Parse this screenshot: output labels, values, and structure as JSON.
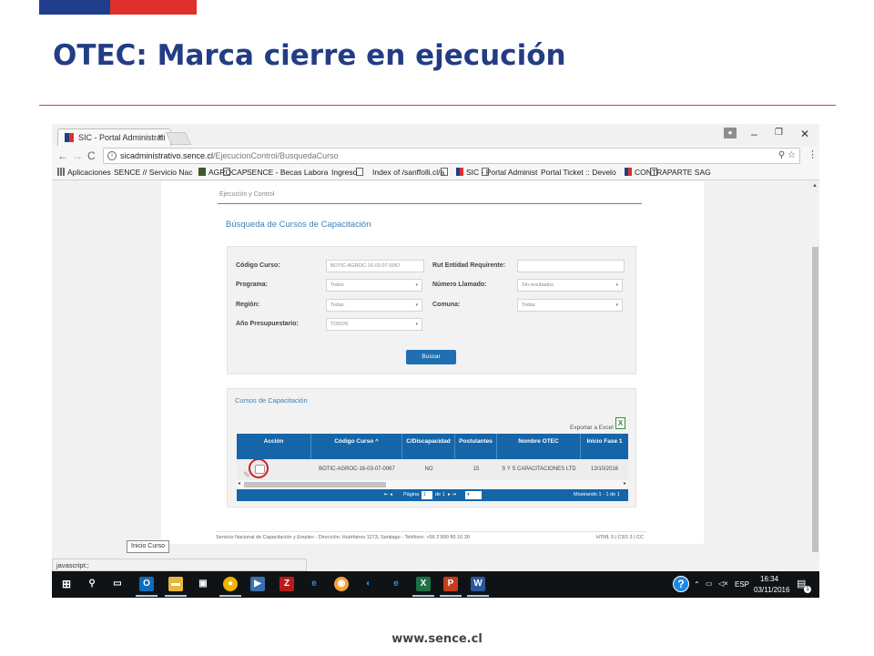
{
  "slide": {
    "title": "OTEC: Marca cierre en ejecución",
    "footer_url": "www.sence.cl",
    "brand_colors": {
      "blue": "#1f3e8c",
      "red": "#e0302c"
    }
  },
  "browser": {
    "tab_title": "SIC - Portal Administrati",
    "tab_close": "×",
    "url_host": "sicadministrativo.sence.cl",
    "url_path": "/EjecucionControl/BusquedaCurso",
    "window_controls": {
      "minimize": "–",
      "restore": "❐",
      "close": "✕"
    },
    "bookmarks": [
      {
        "label": "Aplicaciones",
        "icon": "apps-icon"
      },
      {
        "label": "SENCE // Servicio Nac",
        "icon": "page-icon"
      },
      {
        "label": "AGROCAP",
        "icon": "agrocap-icon"
      },
      {
        "label": "SENCE - Becas Labora",
        "icon": "page-icon"
      },
      {
        "label": "Ingreso",
        "icon": "page-icon"
      },
      {
        "label": "Index of /sanffolli.cl/a",
        "icon": "page-icon"
      },
      {
        "label": "SIC - Portal Administ",
        "icon": "sence-icon"
      },
      {
        "label": "Portal Ticket :: Develo",
        "icon": "page-icon"
      },
      {
        "label": "CONTRAPARTE SAG",
        "icon": "sence-icon"
      }
    ],
    "status_text": "javascript:;"
  },
  "page": {
    "breadcrumb": "Ejecución y Control",
    "heading": "Búsqueda de Cursos de Capacitación",
    "form": {
      "codigo_label": "Código Curso:",
      "codigo_value": "BOTIC-AGROC-16-03-07-0067",
      "rut_label": "Rut Entidad Requirente:",
      "rut_value": "",
      "programa_label": "Programa:",
      "programa_value": "Todos",
      "llamado_label": "Número Llamado:",
      "llamado_value": "Sin resultados",
      "region_label": "Región:",
      "region_value": "Todas",
      "comuna_label": "Comuna:",
      "comuna_value": "Todas",
      "anio_label": "Año Presupuestario:",
      "anio_value": "TODOS",
      "search_button": "Buscar"
    },
    "results": {
      "title": "Cursos de Capacitación",
      "export_label": "Exportar a Excel",
      "columns": [
        "Acción",
        "Código Curso ^",
        "C/Discapacidad",
        "Postulantes",
        "Nombre OTEC",
        "Inicio Fase 1"
      ],
      "rows": [
        {
          "codigo": "BOTIC-AGROC-16-03-07-0067",
          "discapacidad": "NO",
          "postulantes": "15",
          "otec": "S Y S CAPACITACIONES LTD",
          "inicio": "13/10/2016"
        }
      ],
      "pager": {
        "pagina": "Página",
        "page_value": "1",
        "de": "de 1",
        "mostrando": "Mostrando 1 - 1 de 1"
      },
      "tooltip": "Inicio Curso"
    },
    "footer_left": "Servicio Nacional de Capacitación y Empleo - Dirección: Huérfanos 1273, Santiago - Teléfono: +56 2 800 80 10 30",
    "footer_right": "HTML 5 | CSS 3 | CC"
  },
  "taskbar": {
    "lang": "ESP",
    "time": "16:34",
    "date": "03/11/2016",
    "notif_count": "1"
  }
}
